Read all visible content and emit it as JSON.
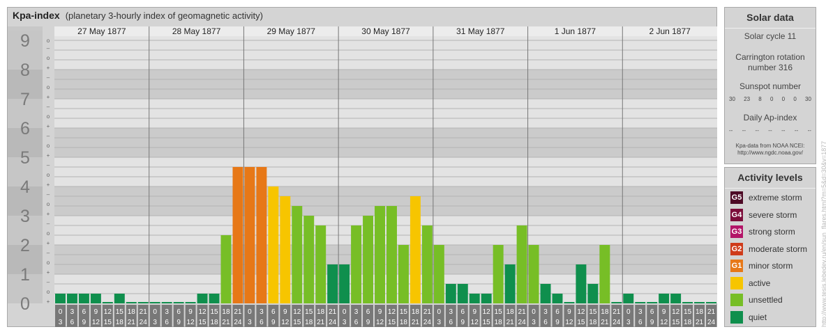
{
  "header": {
    "title": "Kpa-index",
    "subtitle": "(planetary 3-hourly index of geomagnetic activity)"
  },
  "chart_data": {
    "type": "bar",
    "days": [
      "27 May 1877",
      "28 May 1877",
      "29 May 1877",
      "30 May 1877",
      "31 May 1877",
      "1 Jun 1877",
      "2 Jun 1877"
    ],
    "hour_start": [
      "0",
      "3",
      "6",
      "9",
      "12",
      "15",
      "18",
      "21"
    ],
    "hour_end": [
      "3",
      "6",
      "9",
      "12",
      "15",
      "18",
      "21",
      "24"
    ],
    "y_ticks": [
      "0",
      "1",
      "2",
      "3",
      "4",
      "5",
      "6",
      "7",
      "8",
      "9"
    ],
    "sub_ticks": [
      "+",
      "o",
      "–"
    ],
    "ylim": [
      0,
      9
    ],
    "values": [
      0.333,
      0.333,
      0.333,
      0.333,
      0,
      0.333,
      0,
      0,
      0,
      0,
      0,
      0,
      0.333,
      0.333,
      2.333,
      4.667,
      4.667,
      4.667,
      4,
      3.667,
      3.333,
      3,
      2.667,
      1.333,
      1.333,
      2.667,
      3,
      3.333,
      3.333,
      2,
      3.667,
      2.667,
      2,
      0.667,
      0.667,
      0.333,
      0.333,
      2,
      1.333,
      2.667,
      2,
      0.667,
      0.333,
      0,
      1.333,
      0.667,
      2,
      0,
      0.333,
      0,
      0,
      0.333,
      0.333,
      0,
      0,
      0
    ],
    "level_colors": {
      "quiet": "#0f8f4d",
      "unsettled": "#77be26",
      "active": "#f7c500",
      "minor": "#e77817"
    }
  },
  "solar": {
    "title": "Solar data",
    "cycle": "Solar cycle 11",
    "carrington": "Carrington rotation number 316",
    "sunspot_title": "Sunspot number",
    "sunspot_values": [
      "30",
      "23",
      "8",
      "0",
      "0",
      "0",
      "30"
    ],
    "ap_title": "Daily Ap-index",
    "ap_values": [
      "--",
      "--",
      "--",
      "--",
      "--",
      "--",
      "--"
    ],
    "source_line1": "Kpa-data from NOAA NCEI:",
    "source_line2": "http://www.ngdc.noaa.gov/"
  },
  "legend": {
    "title": "Activity levels",
    "items": [
      {
        "badge": "G5",
        "label": "extreme storm",
        "color": "#4d0a25"
      },
      {
        "badge": "G4",
        "label": "severe storm",
        "color": "#7c0d3a"
      },
      {
        "badge": "G3",
        "label": "strong storm",
        "color": "#b31568"
      },
      {
        "badge": "G2",
        "label": "moderate storm",
        "color": "#cf3b1a"
      },
      {
        "badge": "G1",
        "label": "minor storm",
        "color": "#e77817"
      },
      {
        "badge": "",
        "label": "active",
        "color": "#f7c500"
      },
      {
        "badge": "",
        "label": "unsettled",
        "color": "#77be26"
      },
      {
        "badge": "",
        "label": "quiet",
        "color": "#0f8f4d"
      }
    ]
  },
  "watermark": "http://www.tesis.lebedev.ru/en/sun_flares.html?m=5&d=30&y=1877"
}
